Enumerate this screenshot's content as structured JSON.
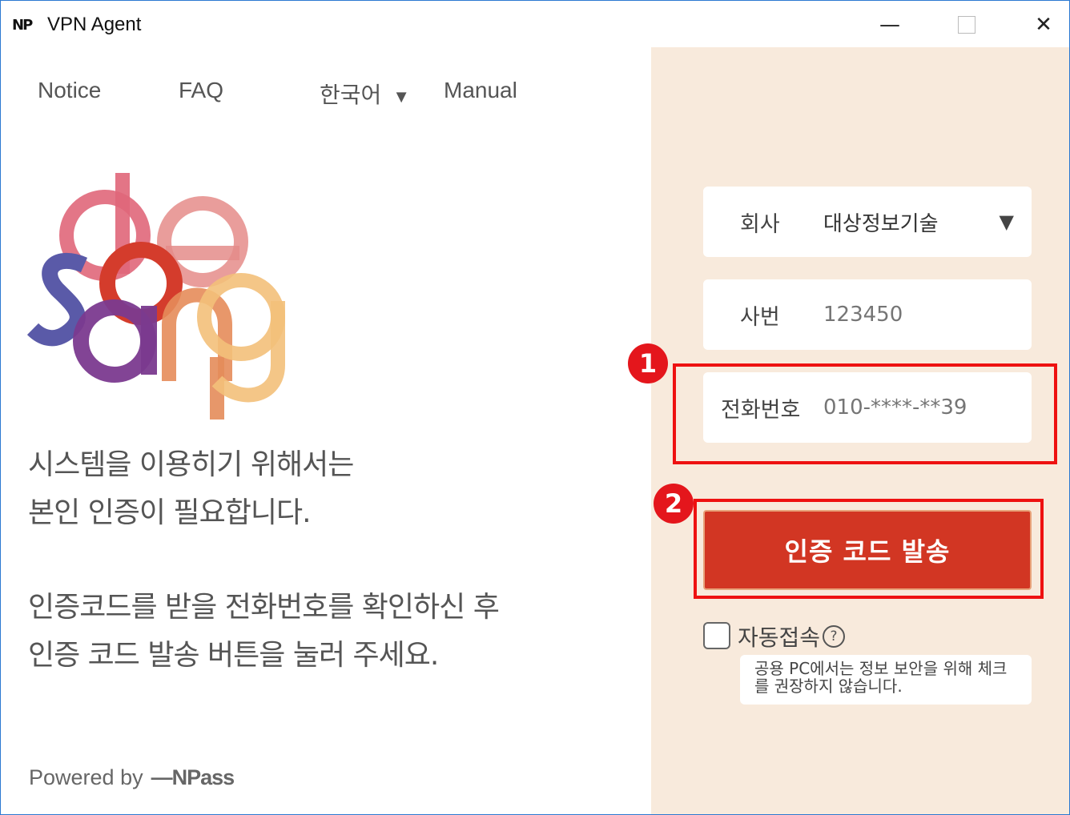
{
  "window": {
    "logo": "NP",
    "title": "VPN Agent",
    "minimize": "—",
    "close": "✕"
  },
  "nav": {
    "notice": "Notice",
    "faq": "FAQ",
    "language": "한국어",
    "language_caret": "▼",
    "manual": "Manual"
  },
  "brand_logo": [
    "d",
    "a",
    "e",
    "s",
    "a",
    "n",
    "g"
  ],
  "message": {
    "line1": "시스템을 이용히기 위해서는",
    "line2": "본인 인증이 필요합니다.",
    "line3": "인증코드를 받을 전화번호를 확인하신 후",
    "line4": "인증 코드 발송 버튼을 눌러 주세요."
  },
  "footer": {
    "powered_by": "Powered by",
    "brand": "—NPass"
  },
  "form": {
    "company_label": "회사",
    "company_value": "대상정보기술",
    "company_caret": "▼",
    "empno_label": "사번",
    "empno_placeholder": "123450",
    "phone_label": "전화번호",
    "phone_placeholder": "010-****-**39",
    "send_button": "인증 코드 발송",
    "auto_connect_label": "자동접속",
    "help_icon": "?",
    "tooltip": "공용 PC에서는 정보 보안을 위해 체크를 권장하지 않습니다."
  },
  "annotations": {
    "marker1": "1",
    "marker2": "2",
    "highlight_color": "#e11111"
  },
  "colors": {
    "panel_bg": "#f8eadc",
    "button_bg": "#d23623",
    "logo_colors": [
      "#e0677a",
      "#5a5aa8",
      "#d43c2c",
      "#7b3a8f",
      "#e58c5a",
      "#f3c07a"
    ]
  }
}
